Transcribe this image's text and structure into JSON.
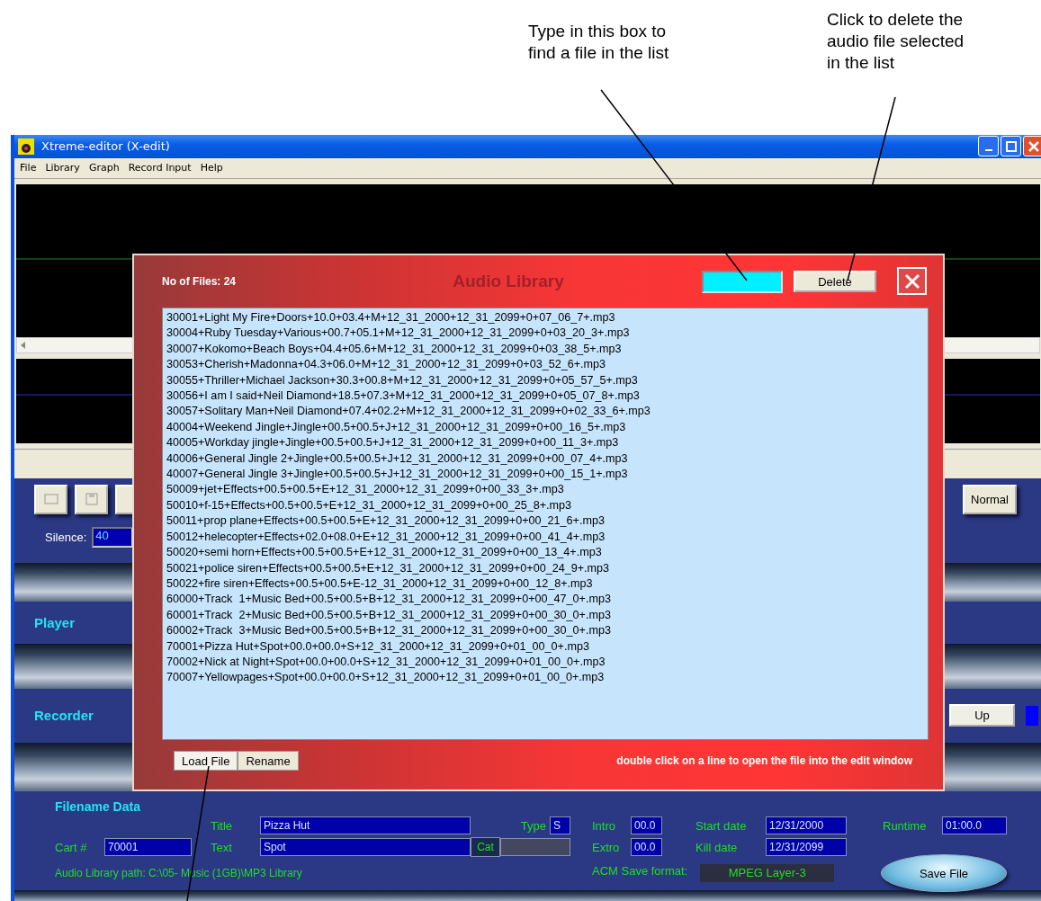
{
  "annotations": [
    {
      "kind": "search",
      "lines": [
        "Type in this box to",
        "find a file in the list"
      ]
    },
    {
      "kind": "delete",
      "lines": [
        "Click to delete the",
        "audio file selected",
        "in the list"
      ]
    }
  ],
  "window": {
    "title": "Xtreme-editor (X-edit)",
    "menu": [
      "File",
      "Library",
      "Graph",
      "Record Input",
      "Help"
    ],
    "toolbar": {
      "mode_button": "Normal"
    },
    "silence": {
      "label": "Silence:",
      "value": "40"
    },
    "sections": [
      {
        "kind": "player",
        "title": "Player"
      },
      {
        "kind": "recorder",
        "title": "Recorder",
        "button": "Up"
      }
    ],
    "filename_data": {
      "heading": "Filename Data",
      "cart": {
        "label": "Cart #",
        "value": "70001"
      },
      "title": {
        "label": "Title",
        "value": "Pizza Hut"
      },
      "text": {
        "label": "Text",
        "value": "Spot"
      },
      "type": {
        "label": "Type",
        "value": "S"
      },
      "cat_button": "Cat",
      "intro": {
        "label": "Intro",
        "value": "00.0"
      },
      "extro": {
        "label": "Extro",
        "value": "00.0"
      },
      "start_date": {
        "label": "Start date",
        "value": "12/31/2000"
      },
      "kill_date": {
        "label": "Kill date",
        "value": "12/31/2099"
      },
      "runtime": {
        "label": "Runtime",
        "value": "01:00.0"
      },
      "library_path": "Audio Library path: C:\\05- Music (1GB)\\MP3 Library",
      "save_format": {
        "label": "ACM Save format:",
        "value": "MPEG Layer-3"
      },
      "save_button": "Save File"
    }
  },
  "dialog": {
    "count": "No of Files: 24",
    "title": "Audio Library",
    "delete_button": "Delete",
    "files": [
      "30001+Light My Fire+Doors+10.0+03.4+M+12_31_2000+12_31_2099+0+07_06_7+.mp3",
      "30004+Ruby Tuesday+Various+00.7+05.1+M+12_31_2000+12_31_2099+0+03_20_3+.mp3",
      "30007+Kokomo+Beach Boys+04.4+05.6+M+12_31_2000+12_31_2099+0+03_38_5+.mp3",
      "30053+Cherish+Madonna+04.3+06.0+M+12_31_2000+12_31_2099+0+03_52_6+.mp3",
      "30055+Thriller+Michael Jackson+30.3+00.8+M+12_31_2000+12_31_2099+0+05_57_5+.mp3",
      "30056+I am I said+Neil Diamond+18.5+07.3+M+12_31_2000+12_31_2099+0+05_07_8+.mp3",
      "30057+Solitary Man+Neil Diamond+07.4+02.2+M+12_31_2000+12_31_2099+0+02_33_6+.mp3",
      "40004+Weekend Jingle+Jingle+00.5+00.5+J+12_31_2000+12_31_2099+0+00_16_5+.mp3",
      "40005+Workday jingle+Jingle+00.5+00.5+J+12_31_2000+12_31_2099+0+00_11_3+.mp3",
      "40006+General Jingle 2+Jingle+00.5+00.5+J+12_31_2000+12_31_2099+0+00_07_4+.mp3",
      "40007+General Jingle 3+Jingle+00.5+00.5+J+12_31_2000+12_31_2099+0+00_15_1+.mp3",
      "50009+jet+Effects+00.5+00.5+E+12_31_2000+12_31_2099+0+00_33_3+.mp3",
      "50010+f-15+Effects+00.5+00.5+E+12_31_2000+12_31_2099+0+00_25_8+.mp3",
      "50011+prop plane+Effects+00.5+00.5+E+12_31_2000+12_31_2099+0+00_21_6+.mp3",
      "50012+helecopter+Effects+02.0+08.0+E+12_31_2000+12_31_2099+0+00_41_4+.mp3",
      "50020+semi horn+Effects+00.5+00.5+E+12_31_2000+12_31_2099+0+00_13_4+.mp3",
      "50021+police siren+Effects+00.5+00.5+E+12_31_2000+12_31_2099+0+00_24_9+.mp3",
      "50022+fire siren+Effects+00.5+00.5+E-12_31_2000+12_31_2099+0+00_12_8+.mp3",
      "60000+Track  1+Music Bed+00.5+00.5+B+12_31_2000+12_31_2099+0+00_47_0+.mp3",
      "60001+Track  2+Music Bed+00.5+00.5+B+12_31_2000+12_31_2099+0+00_30_0+.mp3",
      "60002+Track  3+Music Bed+00.5+00.5+B+12_31_2000+12_31_2099+0+00_30_0+.mp3",
      "70001+Pizza Hut+Spot+00.0+00.0+S+12_31_2000+12_31_2099+0+01_00_0+.mp3",
      "70002+Nick at Night+Spot+00.0+00.0+S+12_31_2000+12_31_2099+0+01_00_0+.mp3",
      "70007+Yellowpages+Spot+00.0+00.0+S+12_31_2000+12_31_2099+0+01_00_0+.mp3"
    ],
    "buttons": [
      "Load File",
      "Rename"
    ],
    "hint": "double click on a line to open the file into the edit window"
  }
}
